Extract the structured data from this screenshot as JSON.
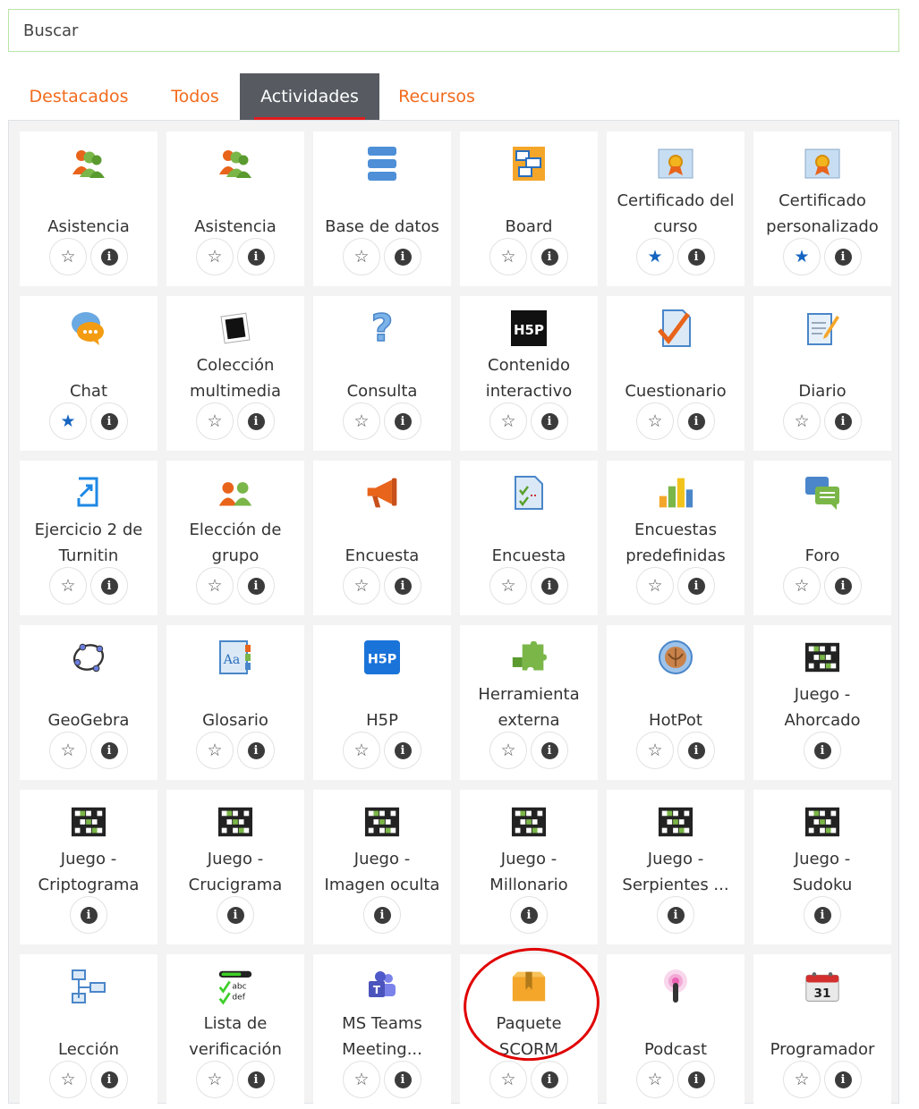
{
  "search": {
    "placeholder": "Buscar"
  },
  "tabs": [
    {
      "label": "Destacados",
      "active": false
    },
    {
      "label": "Todos",
      "active": false
    },
    {
      "label": "Actividades",
      "active": true
    },
    {
      "label": "Recursos",
      "active": false
    }
  ],
  "modules": [
    {
      "label": "Asistencia",
      "icon": "attendance-icon",
      "starred": false,
      "has_star": true
    },
    {
      "label": "Asistencia",
      "icon": "attendance-icon",
      "starred": false,
      "has_star": true
    },
    {
      "label": "Base de datos",
      "icon": "database-icon",
      "starred": false,
      "has_star": true
    },
    {
      "label": "Board",
      "icon": "board-icon",
      "starred": false,
      "has_star": true
    },
    {
      "label": "Certificado del\ncurso",
      "icon": "certificate-icon",
      "starred": true,
      "has_star": true
    },
    {
      "label": "Certificado\npersonalizado",
      "icon": "certificate-icon",
      "starred": true,
      "has_star": true
    },
    {
      "label": "Chat",
      "icon": "chat-icon",
      "starred": true,
      "has_star": true
    },
    {
      "label": "Colección\nmultimedia",
      "icon": "media-collection-icon",
      "starred": false,
      "has_star": true
    },
    {
      "label": "Consulta",
      "icon": "question-mark-icon",
      "starred": false,
      "has_star": true
    },
    {
      "label": "Contenido\ninteractivo",
      "icon": "h5p-black-icon",
      "starred": false,
      "has_star": true
    },
    {
      "label": "Cuestionario",
      "icon": "quiz-icon",
      "starred": false,
      "has_star": true
    },
    {
      "label": "Diario",
      "icon": "journal-icon",
      "starred": false,
      "has_star": true
    },
    {
      "label": "Ejercicio 2 de\nTurnitin",
      "icon": "turnitin-icon",
      "starred": false,
      "has_star": true
    },
    {
      "label": "Elección de\ngrupo",
      "icon": "group-choice-icon",
      "starred": false,
      "has_star": true
    },
    {
      "label": "Encuesta",
      "icon": "megaphone-icon",
      "starred": false,
      "has_star": true
    },
    {
      "label": "Encuesta",
      "icon": "survey-icon",
      "starred": false,
      "has_star": true
    },
    {
      "label": "Encuestas\npredefinidas",
      "icon": "bar-chart-icon",
      "starred": false,
      "has_star": true
    },
    {
      "label": "Foro",
      "icon": "forum-icon",
      "starred": false,
      "has_star": true
    },
    {
      "label": "GeoGebra",
      "icon": "geogebra-icon",
      "starred": false,
      "has_star": true
    },
    {
      "label": "Glosario",
      "icon": "glossary-icon",
      "starred": false,
      "has_star": true
    },
    {
      "label": "H5P",
      "icon": "h5p-blue-icon",
      "starred": false,
      "has_star": true
    },
    {
      "label": "Herramienta\nexterna",
      "icon": "puzzle-icon",
      "starred": false,
      "has_star": true
    },
    {
      "label": "HotPot",
      "icon": "hotpot-icon",
      "starred": false,
      "has_star": true
    },
    {
      "label": "Juego -\nAhorcado",
      "icon": "game-icon",
      "starred": false,
      "has_star": false
    },
    {
      "label": "Juego -\nCriptograma",
      "icon": "game-icon",
      "starred": false,
      "has_star": false
    },
    {
      "label": "Juego -\nCrucigrama",
      "icon": "game-icon",
      "starred": false,
      "has_star": false
    },
    {
      "label": "Juego -\nImagen oculta",
      "icon": "game-icon",
      "starred": false,
      "has_star": false
    },
    {
      "label": "Juego -\nMillonario",
      "icon": "game-icon",
      "starred": false,
      "has_star": false
    },
    {
      "label": "Juego -\nSerpientes ...",
      "icon": "game-icon",
      "starred": false,
      "has_star": false
    },
    {
      "label": "Juego -\nSudoku",
      "icon": "game-icon",
      "starred": false,
      "has_star": false
    },
    {
      "label": "Lección",
      "icon": "lesson-icon",
      "starred": false,
      "has_star": true
    },
    {
      "label": "Lista de\nverificación",
      "icon": "checklist-icon",
      "starred": false,
      "has_star": true
    },
    {
      "label": "MS Teams\nMeeting...",
      "icon": "teams-icon",
      "starred": false,
      "has_star": true
    },
    {
      "label": "Paquete\nSCORM",
      "icon": "scorm-package-icon",
      "starred": false,
      "has_star": true
    },
    {
      "label": "Podcast",
      "icon": "podcast-icon",
      "starred": false,
      "has_star": true
    },
    {
      "label": "Programador",
      "icon": "calendar-icon",
      "starred": false,
      "has_star": true
    }
  ],
  "symbols": {
    "star_empty": "☆",
    "star_full": "★",
    "info": "i",
    "h5p": "H5P",
    "calendar_day": "31",
    "checklist_abc": "abc",
    "checklist_def": "def",
    "question": "?"
  },
  "colors": {
    "tab_text": "#f26b1d",
    "tab_active_bg": "#575b61",
    "star_on": "#1565c0",
    "highlight_ring": "#e00000"
  }
}
